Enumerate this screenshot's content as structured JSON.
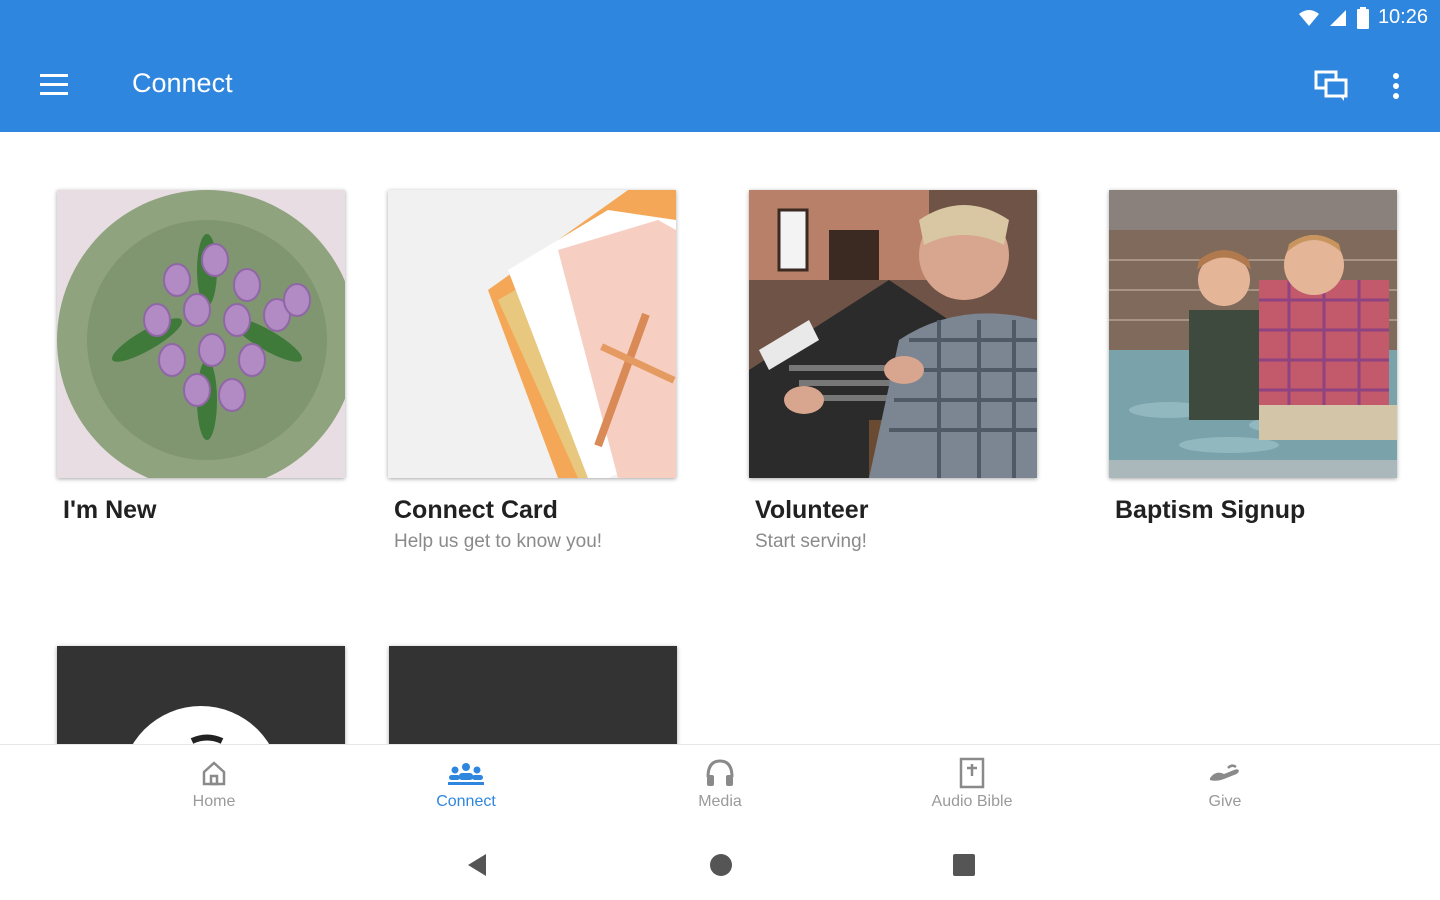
{
  "status_bar": {
    "time": "10:26",
    "icons": [
      "wifi-icon",
      "signal-icon",
      "battery-icon"
    ]
  },
  "app_bar": {
    "title": "Connect",
    "actions": [
      "chat-icon",
      "more-vert-icon"
    ],
    "color": "#2f86de"
  },
  "cards": [
    {
      "title": "I'm New",
      "subtitle": ""
    },
    {
      "title": "Connect Card",
      "subtitle": "Help us get to know you!"
    },
    {
      "title": "Volunteer",
      "subtitle": "Start serving!"
    },
    {
      "title": "Baptism Signup",
      "subtitle": ""
    }
  ],
  "bottom_nav": {
    "items": [
      {
        "label": "Home",
        "icon": "home-icon",
        "active": false
      },
      {
        "label": "Connect",
        "icon": "people-icon",
        "active": true
      },
      {
        "label": "Media",
        "icon": "headphones-icon",
        "active": false
      },
      {
        "label": "Audio Bible",
        "icon": "bible-icon",
        "active": false
      },
      {
        "label": "Give",
        "icon": "give-icon",
        "active": false
      }
    ]
  },
  "system_nav": [
    "back-icon",
    "home-circle-icon",
    "recents-icon"
  ]
}
